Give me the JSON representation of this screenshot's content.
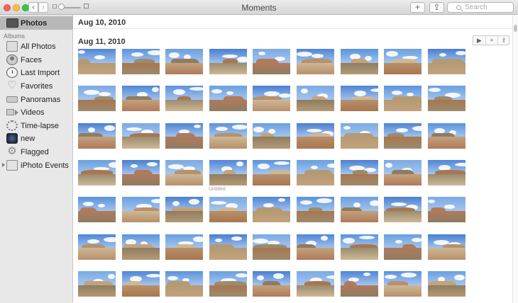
{
  "window": {
    "title": "Moments"
  },
  "toolbar": {
    "back": "‹",
    "forward": "›",
    "add": "+",
    "share": "⇪",
    "search_placeholder": "Search",
    "zoom_level": 0.1
  },
  "sidebar": {
    "top_item": "Photos",
    "header": "Albums",
    "items": [
      {
        "label": "All Photos",
        "icon": "folder-icon"
      },
      {
        "label": "Faces",
        "icon": "person-icon"
      },
      {
        "label": "Last Import",
        "icon": "clock-icon"
      },
      {
        "label": "Favorites",
        "icon": "heart-icon"
      },
      {
        "label": "Panoramas",
        "icon": "panorama-icon"
      },
      {
        "label": "Videos",
        "icon": "video-icon"
      },
      {
        "label": "Time-lapse",
        "icon": "timelapse-icon"
      },
      {
        "label": "new",
        "icon": "album-thumbnail-icon"
      },
      {
        "label": "Flagged",
        "icon": "flag-icon"
      },
      {
        "label": "iPhoto Events",
        "icon": "folder-icon"
      }
    ]
  },
  "main": {
    "moments": [
      {
        "date": "Aug 10, 2010"
      },
      {
        "date": "Aug 11, 2010"
      }
    ],
    "moment_actions": {
      "play": "▶",
      "add": "+",
      "share": "⇪"
    },
    "untitled_label": "Untitled",
    "grid": {
      "rows": 7,
      "cols": 9
    }
  },
  "colors": {
    "sidebar_bg": "#e8e8e8",
    "selected_bg": "#b8b8b8",
    "sky": "#4a7fd0"
  }
}
